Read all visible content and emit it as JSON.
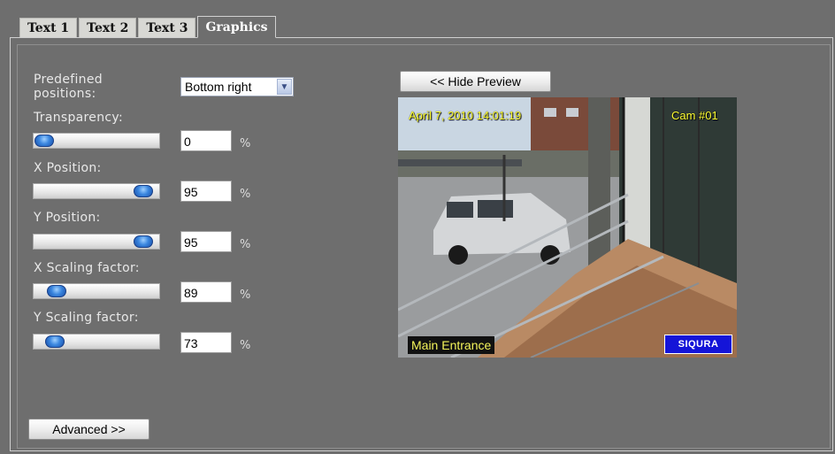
{
  "tabs": [
    {
      "label": "Text 1",
      "active": false
    },
    {
      "label": "Text 2",
      "active": false
    },
    {
      "label": "Text 3",
      "active": false
    },
    {
      "label": "Graphics",
      "active": true
    }
  ],
  "settings": {
    "predefined_label_line1": "Predefined",
    "predefined_label_line2": "positions:",
    "predefined_value": "Bottom right",
    "unit": "%",
    "transparency": {
      "label": "Transparency:",
      "value": "0"
    },
    "x_position": {
      "label": "X Position:",
      "value": "95"
    },
    "y_position": {
      "label": "Y Position:",
      "value": "95"
    },
    "x_scaling": {
      "label": "X Scaling factor:",
      "value": "89"
    },
    "y_scaling": {
      "label": "Y Scaling factor:",
      "value": "73"
    }
  },
  "buttons": {
    "hide_preview": "<< Hide Preview",
    "advanced": "Advanced >>"
  },
  "preview": {
    "timestamp": "April 7, 2010 14:01:19",
    "camera": "Cam #01",
    "caption": "Main Entrance",
    "logo": "SIQURA"
  },
  "colors": {
    "background": "#6e6e6e",
    "overlay_text": "#ffff33",
    "logo_bg": "#1414d8",
    "slider_thumb": "#3a86df"
  }
}
